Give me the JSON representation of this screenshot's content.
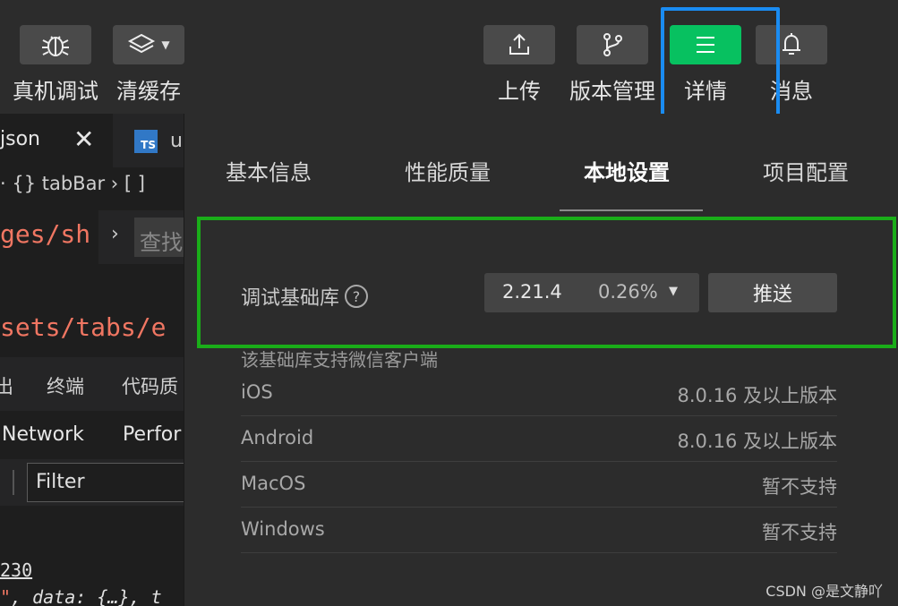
{
  "toolbar": {
    "left_buttons": [
      {
        "icon": "bug-icon",
        "label": "真机调试"
      },
      {
        "icon": "layers-icon",
        "label": "清缓存"
      }
    ],
    "right_buttons": [
      {
        "icon": "upload-icon",
        "label": "上传"
      },
      {
        "icon": "branch-icon",
        "label": "版本管理"
      },
      {
        "icon": "menu-icon",
        "label": "详情",
        "active": true
      },
      {
        "icon": "bell-icon",
        "label": "消息"
      }
    ],
    "accent_green": "#07c160",
    "highlight_blue": "#1a8cf2"
  },
  "editor": {
    "file_tab": "json",
    "file_tab_close": "✕",
    "ts_badge": "TS",
    "second_tab_fragment": "u",
    "breadcrumb": "· {} tabBar › [ ]",
    "code_line_1": "ges/sh",
    "find_chevron": "›",
    "find_placeholder": "查找",
    "code_line_2": "sets/tabs/e",
    "panel_tabs": [
      "出",
      "终端",
      "代码质"
    ],
    "devtools_tabs": [
      "Network",
      "Perfor"
    ],
    "filter_placeholder": "Filter",
    "console_line_1": "230",
    "console_line_2_str": "\"",
    "console_line_2_rest": ", data: {…}, t"
  },
  "details": {
    "tabs": [
      "基本信息",
      "性能质量",
      "本地设置",
      "项目配置"
    ],
    "active_tab": "本地设置",
    "lib_label": "调试基础库",
    "help_icon_glyph": "?",
    "lib_version": "2.21.4",
    "lib_share": "0.26%",
    "push_label": "推送",
    "support_title": "该基础库支持微信客户端",
    "support_rows": [
      {
        "platform": "iOS",
        "value": "8.0.16 及以上版本"
      },
      {
        "platform": "Android",
        "value": "8.0.16 及以上版本"
      },
      {
        "platform": "MacOS",
        "value": "暂不支持"
      },
      {
        "platform": "Windows",
        "value": "暂不支持"
      }
    ],
    "highlight_green": "#1aad19"
  },
  "watermark": "CSDN @是文静吖"
}
